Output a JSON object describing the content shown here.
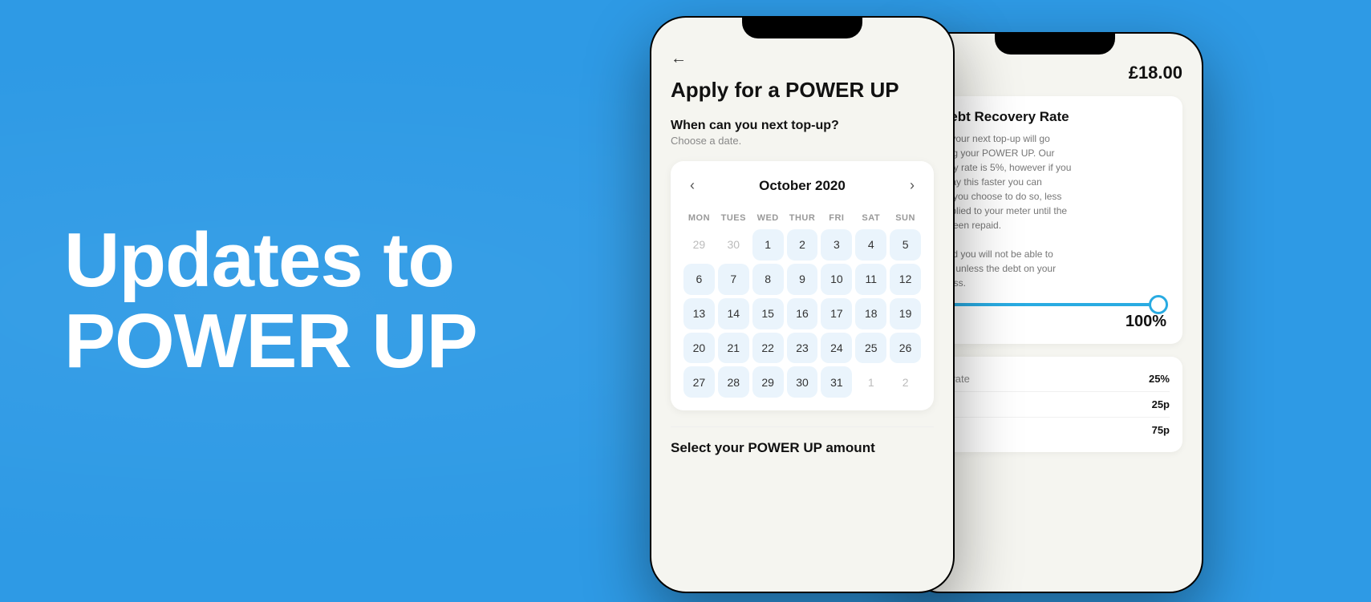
{
  "background": {
    "color": "#2E9AE5"
  },
  "headline": {
    "line1": "Updates to",
    "line2": "POWER UP"
  },
  "phone1": {
    "back_arrow": "←",
    "title": "Apply for a POWER UP",
    "question": "When can you next top-up?",
    "subtext": "Choose a date.",
    "calendar": {
      "month": "October 2020",
      "prev_arrow": "‹",
      "next_arrow": "›",
      "days_of_week": [
        "MON",
        "TUES",
        "WED",
        "THUR",
        "FRI",
        "SAT",
        "SUN"
      ],
      "weeks": [
        [
          {
            "num": "29",
            "active": false
          },
          {
            "num": "30",
            "active": false
          },
          {
            "num": "1",
            "active": true
          },
          {
            "num": "2",
            "active": true
          },
          {
            "num": "3",
            "active": true
          },
          {
            "num": "4",
            "active": true
          },
          {
            "num": "5",
            "active": true
          }
        ],
        [
          {
            "num": "6",
            "active": true
          },
          {
            "num": "7",
            "active": true
          },
          {
            "num": "8",
            "active": true
          },
          {
            "num": "9",
            "active": true
          },
          {
            "num": "10",
            "active": true
          },
          {
            "num": "11",
            "active": true
          },
          {
            "num": "12",
            "active": true
          }
        ],
        [
          {
            "num": "13",
            "active": true
          },
          {
            "num": "14",
            "active": true
          },
          {
            "num": "15",
            "active": true
          },
          {
            "num": "16",
            "active": true
          },
          {
            "num": "17",
            "active": true
          },
          {
            "num": "18",
            "active": true
          },
          {
            "num": "19",
            "active": true
          }
        ],
        [
          {
            "num": "20",
            "active": true
          },
          {
            "num": "21",
            "active": true
          },
          {
            "num": "22",
            "active": true
          },
          {
            "num": "23",
            "active": true
          },
          {
            "num": "24",
            "active": true
          },
          {
            "num": "25",
            "active": true
          },
          {
            "num": "26",
            "active": true
          }
        ],
        [
          {
            "num": "27",
            "active": true
          },
          {
            "num": "28",
            "active": true
          },
          {
            "num": "29",
            "active": true
          },
          {
            "num": "30",
            "active": true
          },
          {
            "num": "31",
            "active": true
          },
          {
            "num": "1",
            "active": false
          },
          {
            "num": "2",
            "active": false
          }
        ]
      ]
    },
    "bottom_title": "Select your POWER UP amount"
  },
  "phone2": {
    "price": "£18.00",
    "debt_title": "Debt Recovery Rate",
    "debt_body": "of your next top-up will go\nving your POWER UP. Our\nvery rate is 5%, however if you\nepay this faster you can\nt if you choose to do so, less\napplied to your meter until the\ns been repaid.\n\nised you will not be able to\nain unless the debt on your\nr less.",
    "slider_percent": "100%",
    "info_rows": [
      {
        "label": "ry rate",
        "value": "25%"
      },
      {
        "label": "",
        "value": "25p"
      },
      {
        "label": "",
        "value": "75p"
      }
    ]
  }
}
